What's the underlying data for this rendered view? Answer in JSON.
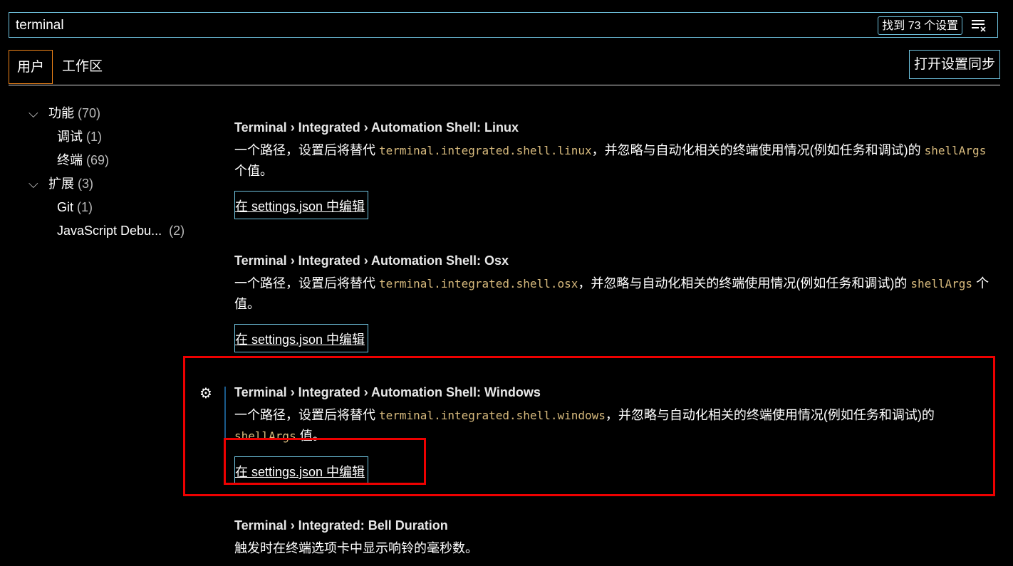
{
  "search": {
    "value": "terminal",
    "result_count": "找到 73 个设置",
    "clear_icon": "clear-filter-icon"
  },
  "tabs": [
    {
      "label": "用户",
      "active": true
    },
    {
      "label": "工作区",
      "active": false
    }
  ],
  "sync_button": "打开设置同步",
  "tree": [
    {
      "label": "功能",
      "count": "(70)",
      "level": 1,
      "expanded": true
    },
    {
      "label": "调试",
      "count": "(1)",
      "level": 2
    },
    {
      "label": "终端",
      "count": "(69)",
      "level": 2
    },
    {
      "label": "扩展",
      "count": "(3)",
      "level": 1,
      "expanded": true
    },
    {
      "label": "Git",
      "count": "(1)",
      "level": 2
    },
    {
      "label": "JavaScript Debu...",
      "count": "(2)",
      "level": 2
    }
  ],
  "settings": [
    {
      "title": "Terminal › Integrated › Automation Shell: Linux",
      "desc_pre": "一个路径，设置后将替代 ",
      "code1": "terminal.integrated.shell.linux",
      "desc_mid": "，并忽略与自动化相关的终端使用情况(例如任务和调试)的 ",
      "code2": "shellArgs",
      "desc_post": " 个值。",
      "edit": "在 settings.json 中编辑"
    },
    {
      "title": "Terminal › Integrated › Automation Shell: Osx",
      "desc_pre": "一个路径，设置后将替代 ",
      "code1": "terminal.integrated.shell.osx",
      "desc_mid": "，并忽略与自动化相关的终端使用情况(例如任务和调试)的 ",
      "code2": "shellArgs",
      "desc_post": " 个值。",
      "edit": "在 settings.json 中编辑"
    },
    {
      "title": "Terminal › Integrated › Automation Shell: Windows",
      "desc_pre": "一个路径，设置后将替代 ",
      "code1": "terminal.integrated.shell.windows",
      "desc_mid": "，并忽略与自动化相关的终端使用情况(例如任务和调试)的 ",
      "code2": "shellArgs",
      "desc_post": " 值。",
      "edit": "在 settings.json 中编辑"
    },
    {
      "title": "Terminal › Integrated: Bell Duration",
      "desc_pre": "触发时在终端选项卡中显示响铃的毫秒数。"
    }
  ],
  "colors": {
    "accent_border": "#6fc3df",
    "active_tab_border": "#f38518",
    "code": "#d7ba7d",
    "annotation": "#e00000"
  }
}
